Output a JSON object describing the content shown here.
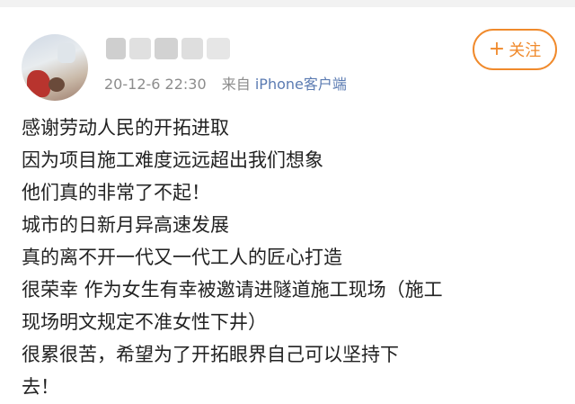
{
  "post": {
    "timestamp": "20-12-6 22:30",
    "source_prefix": "来自",
    "source_app": "iPhone客户端",
    "follow_plus": "+",
    "follow_label": "关注",
    "lines": [
      "感谢劳动人民的开拓进取",
      "因为项目施工难度远远超出我们想象",
      "他们真的非常了不起！",
      "城市的日新月异高速发展",
      "真的离不开一代又一代工人的匠心打造",
      "很荣幸 作为女生有幸被邀请进隧道施工现场（施工",
      "现场明文规定不准女性下井）",
      "很累很苦，希望为了开拓眼界自己可以坚持下",
      "去！"
    ]
  },
  "colors": {
    "accent": "#f08a2c",
    "link": "#5b7bb2",
    "meta": "#8c8c8c",
    "text": "#222222"
  }
}
